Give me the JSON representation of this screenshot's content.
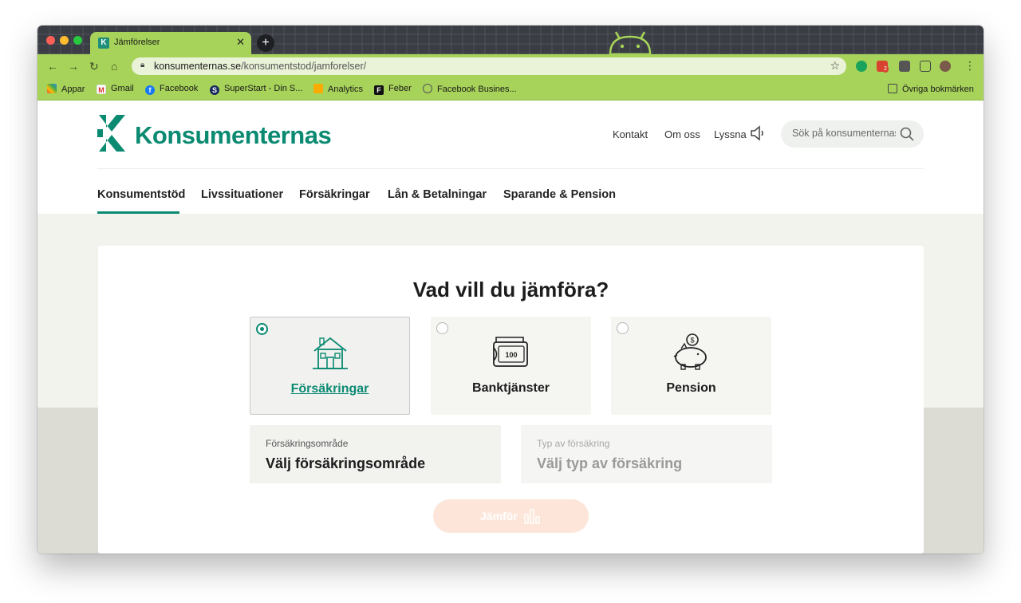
{
  "browser": {
    "tab": {
      "title": "Jämförelser"
    },
    "newtab": "+",
    "url": {
      "host": "konsumenternas.se",
      "path": "/konsumentstod/jamforelser/"
    },
    "mail_badge": "2",
    "bookmarks": [
      {
        "label": "Appar",
        "icon": "apps-grid-icon"
      },
      {
        "label": "Gmail",
        "icon": "gmail-icon"
      },
      {
        "label": "Facebook",
        "icon": "facebook-icon"
      },
      {
        "label": "SuperStart - Din S...",
        "icon": "superstart-icon"
      },
      {
        "label": "Analytics",
        "icon": "analytics-icon"
      },
      {
        "label": "Feber",
        "icon": "feber-icon"
      },
      {
        "label": "Facebook Busines...",
        "icon": "facebook-business-icon"
      }
    ],
    "other_bookmarks": "Övriga bokmärken"
  },
  "site": {
    "logo_text": "Konsumenternas",
    "top_links": [
      "Kontakt",
      "Om oss",
      "Lyssna"
    ],
    "search_placeholder": "Sök på konsumenternas.se",
    "main_nav": [
      "Konsumentstöd",
      "Livssituationer",
      "Försäkringar",
      "Lån & Betalningar",
      "Sparande & Pension"
    ],
    "active_nav": "Konsumentstöd"
  },
  "compare": {
    "title": "Vad vill du jämföra?",
    "options": [
      {
        "label": "Försäkringar",
        "selected": true,
        "icon": "house-icon"
      },
      {
        "label": "Banktjänster",
        "selected": false,
        "icon": "wallet-icon"
      },
      {
        "label": "Pension",
        "selected": false,
        "icon": "piggy-bank-icon"
      }
    ],
    "wallet_amount": "100",
    "area_select": {
      "label": "Försäkringsområde",
      "value": "Välj försäkringsområde"
    },
    "type_select": {
      "label": "Typ av försäkring",
      "value": "Välj typ av försäkring"
    },
    "button_label": "Jämför"
  },
  "colors": {
    "brand": "#0b8a72",
    "chrome": "#a7d35a",
    "button_disabled": "#fde6d9"
  }
}
